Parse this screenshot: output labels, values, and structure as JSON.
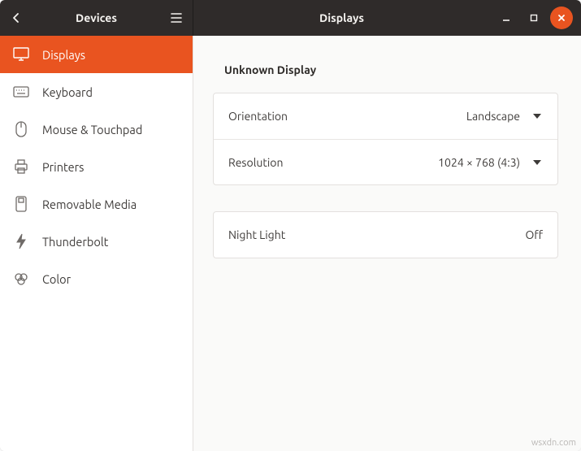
{
  "colors": {
    "accent": "#e95420",
    "titlebar": "#2f2b2a"
  },
  "header": {
    "left_title": "Devices",
    "right_title": "Displays"
  },
  "sidebar": {
    "items": [
      {
        "label": "Displays",
        "icon": "display-icon",
        "active": true
      },
      {
        "label": "Keyboard",
        "icon": "keyboard-icon",
        "active": false
      },
      {
        "label": "Mouse & Touchpad",
        "icon": "mouse-icon",
        "active": false
      },
      {
        "label": "Printers",
        "icon": "printer-icon",
        "active": false
      },
      {
        "label": "Removable Media",
        "icon": "removable-media-icon",
        "active": false
      },
      {
        "label": "Thunderbolt",
        "icon": "thunderbolt-icon",
        "active": false
      },
      {
        "label": "Color",
        "icon": "color-icon",
        "active": false
      }
    ]
  },
  "main": {
    "section_title": "Unknown Display",
    "rows_a": [
      {
        "label": "Orientation",
        "value": "Landscape"
      },
      {
        "label": "Resolution",
        "value": "1024 × 768 (4:3)"
      }
    ],
    "rows_b": [
      {
        "label": "Night Light",
        "value": "Off"
      }
    ]
  },
  "watermark": "wsxdn.com"
}
